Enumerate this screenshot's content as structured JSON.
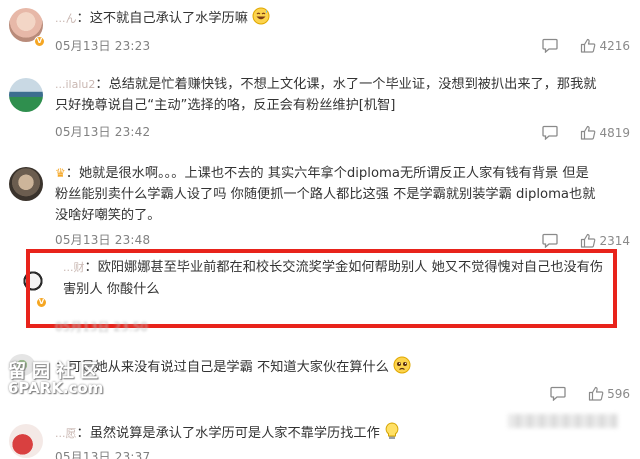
{
  "comments": [
    {
      "username": "...ん",
      "text": "这不就自己承认了水学历嘛",
      "emoji": "grinning-sweat-emoji",
      "time": "05月13日 23:23",
      "likes": "4216"
    },
    {
      "username": "...ilalu2",
      "text": "总结就是忙着赚快钱，不想上文化课，水了一个毕业证，没想到被扒出来了，那我就只好挽尊说自己“主动”选择的咯，反正会有粉丝维护[机智]",
      "time": "05月13日 23:42",
      "likes": "4819"
    },
    {
      "username": "",
      "text": "她就是很水啊。。。上课也不去的 其实六年拿个diploma无所谓反正人家有钱有背景 但是粉丝能别卖什么学霸人设了吗 你随便抓一个路人都比这强 不是学霸就别装学霸 diploma也就没啥好嘲笑的了。",
      "time": "05月13日 23:48",
      "likes": "2314"
    },
    {
      "username": "...财",
      "text": "欧阳娜娜甚至毕业前都在和校长交流奖学金如何帮助别人 她又不觉得愧对自己也没有伤害别人 你酸什么",
      "time": "05月13日 23:50"
    },
    {
      "username": "",
      "text": "可是她从来没有说过自己是学霸 不知道大家伙在算什么",
      "emoji": "pleading-emoji",
      "likes": "596"
    },
    {
      "username": "...愿",
      "text": "虽然说算是承认了水学历可是人家不靠学历找工作",
      "emoji": "thinking-lightbulb-emoji",
      "time": "05月13日 23:37"
    }
  ],
  "watermark": {
    "chinese": "留园社区",
    "english": "6PARK.com"
  },
  "icons": {
    "comment": "comment-bubble-icon",
    "like": "thumbs-up-icon",
    "verified": "verified-badge-icon",
    "crown": "crown-icon"
  },
  "colors": {
    "highlight_border": "#e8231b",
    "username": "#eb7350",
    "meta_text": "#808080",
    "badge": "#f5a623"
  }
}
